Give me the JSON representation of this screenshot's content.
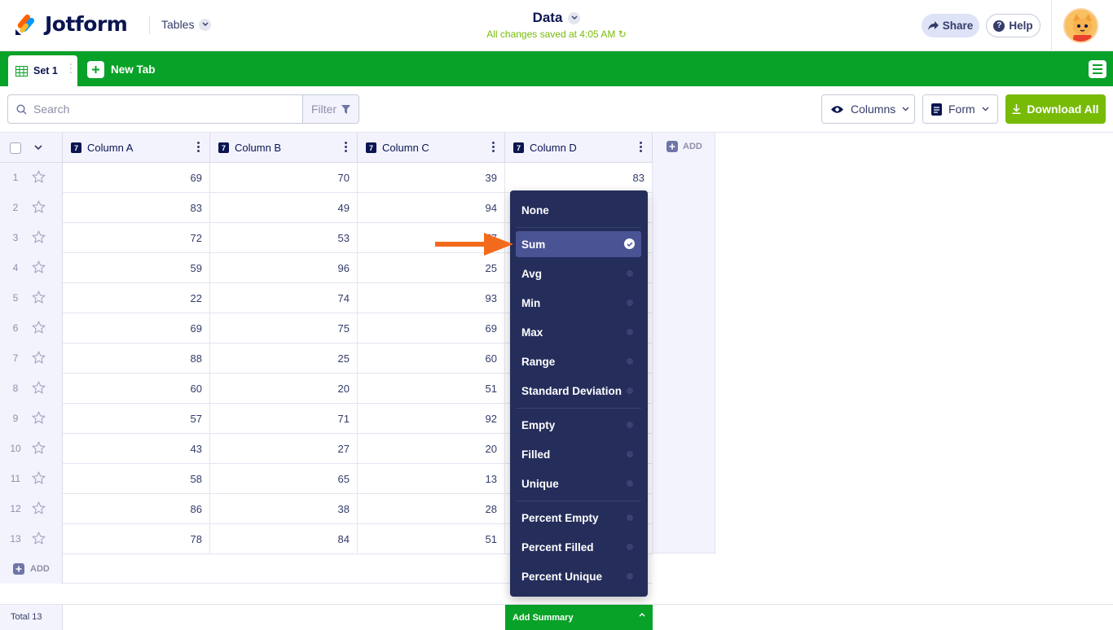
{
  "header": {
    "logo_text": "Jotform",
    "section": "Tables",
    "title": "Data",
    "saved_status": "All changes saved at 4:05 AM",
    "share_label": "Share",
    "help_label": "Help"
  },
  "tabs": {
    "active": "Set 1",
    "new_tab": "New Tab"
  },
  "toolbar": {
    "search_placeholder": "Search",
    "filter_label": "Filter",
    "columns_label": "Columns",
    "form_label": "Form",
    "download_label": "Download All"
  },
  "table": {
    "columns": [
      {
        "label": "Column A",
        "type_badge": "7"
      },
      {
        "label": "Column B",
        "type_badge": "7"
      },
      {
        "label": "Column C",
        "type_badge": "7"
      },
      {
        "label": "Column D",
        "type_badge": "7"
      }
    ],
    "add_column_label": "ADD",
    "add_row_label": "ADD",
    "rows": [
      {
        "n": "1",
        "a": "69",
        "b": "70",
        "c": "39",
        "d": "83"
      },
      {
        "n": "2",
        "a": "83",
        "b": "49",
        "c": "94",
        "d": ""
      },
      {
        "n": "3",
        "a": "72",
        "b": "53",
        "c": "77",
        "d": ""
      },
      {
        "n": "4",
        "a": "59",
        "b": "96",
        "c": "25",
        "d": ""
      },
      {
        "n": "5",
        "a": "22",
        "b": "74",
        "c": "93",
        "d": ""
      },
      {
        "n": "6",
        "a": "69",
        "b": "75",
        "c": "69",
        "d": ""
      },
      {
        "n": "7",
        "a": "88",
        "b": "25",
        "c": "60",
        "d": ""
      },
      {
        "n": "8",
        "a": "60",
        "b": "20",
        "c": "51",
        "d": ""
      },
      {
        "n": "9",
        "a": "57",
        "b": "71",
        "c": "92",
        "d": ""
      },
      {
        "n": "10",
        "a": "43",
        "b": "27",
        "c": "20",
        "d": ""
      },
      {
        "n": "11",
        "a": "58",
        "b": "65",
        "c": "13",
        "d": ""
      },
      {
        "n": "12",
        "a": "86",
        "b": "38",
        "c": "28",
        "d": ""
      },
      {
        "n": "13",
        "a": "78",
        "b": "84",
        "c": "51",
        "d": ""
      }
    ]
  },
  "footer": {
    "total_label": "Total 13",
    "add_summary_label": "Add Summary"
  },
  "summary_menu": {
    "selected": "Sum",
    "groups": [
      [
        "None"
      ],
      [
        "Sum",
        "Avg",
        "Min",
        "Max",
        "Range",
        "Standard Deviation"
      ],
      [
        "Empty",
        "Filled",
        "Unique"
      ],
      [
        "Percent Empty",
        "Percent Filled",
        "Percent Unique"
      ]
    ]
  },
  "colors": {
    "brand_green": "#09a228",
    "download_green": "#78bb07",
    "navy": "#0a1551",
    "menu_bg": "#252d5b",
    "menu_selected": "#4a5394",
    "pointer_arrow": "#f26b1d"
  }
}
